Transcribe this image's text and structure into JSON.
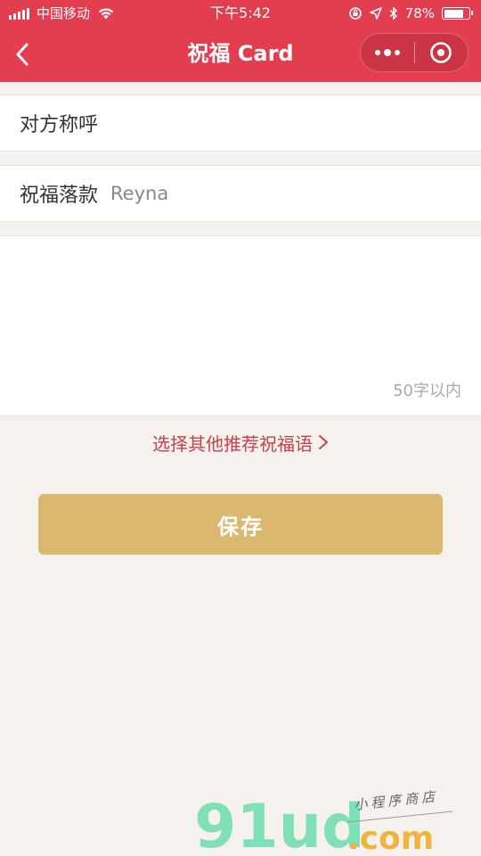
{
  "status_bar": {
    "carrier": "中国移动",
    "time": "下午5:42",
    "battery_percent": "78%",
    "battery_level": 0.78
  },
  "nav": {
    "title": "祝福 Card",
    "icons": [
      "chevron-left-icon",
      "more-dots-icon",
      "target-circle-icon"
    ]
  },
  "form": {
    "recipient_label": "对方称呼",
    "recipient_value": "",
    "sender_label": "祝福落款",
    "sender_value": "Reyna",
    "message_value": "",
    "char_limit_hint": "50字以内"
  },
  "actions": {
    "more_greetings": "选择其他推荐祝福语",
    "save": "保存"
  },
  "watermark": {
    "logo_text": "91ud",
    "domain": ".com",
    "tagline": "小程序商店"
  },
  "colors": {
    "header": "#e23e4f",
    "background": "#f5f1ec",
    "accent_link": "#c8404e",
    "save_button": "#dbb870"
  }
}
